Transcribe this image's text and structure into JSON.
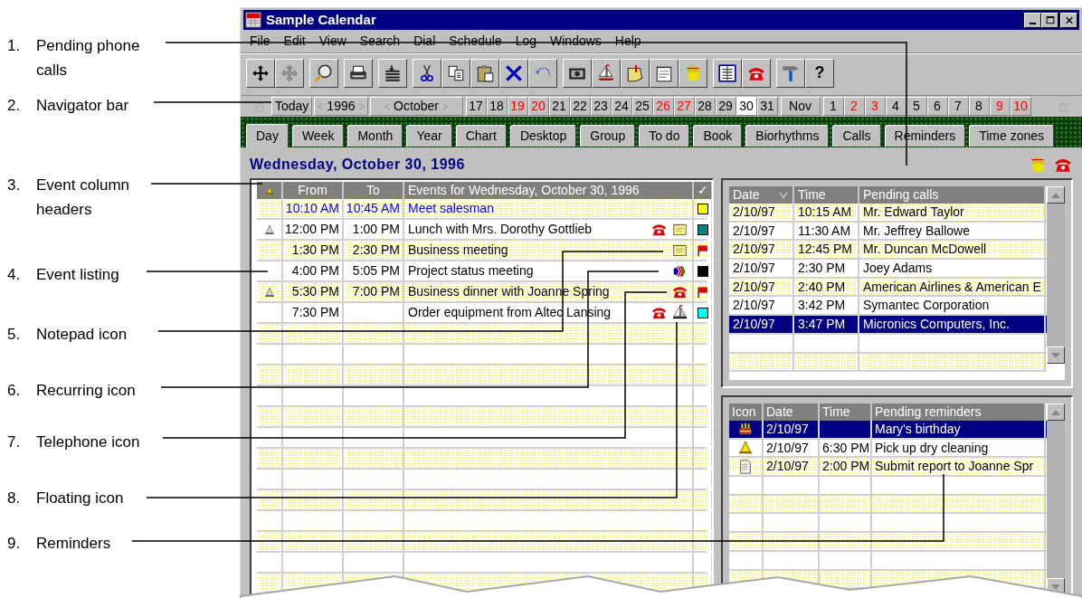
{
  "callouts": [
    {
      "number": "1.",
      "label": "Pending phone calls"
    },
    {
      "number": "2.",
      "label": "Navigator bar"
    },
    {
      "number": "3.",
      "label": "Event column headers"
    },
    {
      "number": "4.",
      "label": "Event listing"
    },
    {
      "number": "5.",
      "label": "Notepad icon"
    },
    {
      "number": "6.",
      "label": "Recurring icon"
    },
    {
      "number": "7.",
      "label": "Telephone icon"
    },
    {
      "number": "8.",
      "label": "Floating icon"
    },
    {
      "number": "9.",
      "label": "Reminders"
    }
  ],
  "window": {
    "title": "Sample Calendar"
  },
  "menu": [
    "File",
    "Edit",
    "View",
    "Search",
    "Dial",
    "Schedule",
    "Log",
    "Windows",
    "Help"
  ],
  "toolbar": {
    "help_label": "?"
  },
  "navigator": {
    "today": "Today",
    "year": "1996",
    "month": "October",
    "days": [
      {
        "label": "17",
        "weekend": false,
        "selected": false
      },
      {
        "label": "18",
        "weekend": false,
        "selected": false
      },
      {
        "label": "19",
        "weekend": true,
        "selected": false
      },
      {
        "label": "20",
        "weekend": true,
        "selected": false
      },
      {
        "label": "21",
        "weekend": false,
        "selected": false
      },
      {
        "label": "22",
        "weekend": false,
        "selected": false
      },
      {
        "label": "23",
        "weekend": false,
        "selected": false
      },
      {
        "label": "24",
        "weekend": false,
        "selected": false
      },
      {
        "label": "25",
        "weekend": false,
        "selected": false
      },
      {
        "label": "26",
        "weekend": true,
        "selected": false
      },
      {
        "label": "27",
        "weekend": true,
        "selected": false
      },
      {
        "label": "28",
        "weekend": false,
        "selected": false
      },
      {
        "label": "29",
        "weekend": false,
        "selected": false
      },
      {
        "label": "30",
        "weekend": false,
        "selected": true
      },
      {
        "label": "31",
        "weekend": false,
        "selected": false
      }
    ],
    "next_month": "Nov",
    "next_days": [
      {
        "label": "1",
        "weekend": false,
        "selected": false
      },
      {
        "label": "2",
        "weekend": true,
        "selected": false
      },
      {
        "label": "3",
        "weekend": true,
        "selected": false
      },
      {
        "label": "4",
        "weekend": false,
        "selected": false
      },
      {
        "label": "5",
        "weekend": false,
        "selected": false
      },
      {
        "label": "6",
        "weekend": false,
        "selected": false
      },
      {
        "label": "7",
        "weekend": false,
        "selected": false
      },
      {
        "label": "8",
        "weekend": false,
        "selected": false
      },
      {
        "label": "9",
        "weekend": true,
        "selected": false
      },
      {
        "label": "10",
        "weekend": true,
        "selected": false
      }
    ]
  },
  "tabs": [
    {
      "label": "Day",
      "selected": true
    },
    {
      "label": "Week",
      "selected": false
    },
    {
      "label": "Month",
      "selected": false
    },
    {
      "label": "Year",
      "selected": false
    },
    {
      "label": "Chart",
      "selected": false
    },
    {
      "label": "Desktop",
      "selected": false
    },
    {
      "label": "Group",
      "selected": false
    },
    {
      "label": "To do",
      "selected": false
    },
    {
      "label": "Book",
      "selected": false
    },
    {
      "label": "Biorhythms",
      "selected": false
    },
    {
      "label": "Calls",
      "selected": false
    },
    {
      "label": "Reminders",
      "selected": false
    },
    {
      "label": "Time zones",
      "selected": false
    }
  ],
  "date_heading": "Wednesday, October 30, 1996",
  "events": {
    "columns": [
      "From",
      "To",
      "Events for Wednesday, October 30, 1996",
      "✓"
    ],
    "rows": [
      {
        "alarm": false,
        "current": true,
        "from": "10:10 AM",
        "to": "10:45 AM",
        "title": "Meet salesman",
        "icons": [],
        "marker": {
          "kind": "square",
          "color": "#ffff00"
        }
      },
      {
        "alarm": true,
        "current": false,
        "from": "12:00 PM",
        "to": "1:00 PM",
        "title": "Lunch with Mrs. Dorothy Gottlieb",
        "icons": [
          {
            "kind": "phone"
          },
          {
            "kind": "notepad"
          }
        ],
        "marker": {
          "kind": "square",
          "color": "#008080"
        }
      },
      {
        "alarm": false,
        "current": false,
        "from": "1:30 PM",
        "to": "2:30 PM",
        "title": "Business meeting",
        "icons": [
          {
            "kind": "notepad"
          }
        ],
        "marker": {
          "kind": "flag"
        }
      },
      {
        "alarm": false,
        "current": false,
        "from": "4:00 PM",
        "to": "5:05 PM",
        "title": "Project status meeting",
        "icons": [
          {
            "kind": "recurring"
          }
        ],
        "marker": {
          "kind": "square",
          "color": "#000000"
        }
      },
      {
        "alarm": true,
        "current": false,
        "from": "5:30 PM",
        "to": "7:00 PM",
        "title": "Business dinner with Joanne Spring",
        "icons": [
          {
            "kind": "phone"
          }
        ],
        "marker": {
          "kind": "flag"
        }
      },
      {
        "alarm": false,
        "current": false,
        "from": "7:30 PM",
        "title": "Order equipment from Altec Lansing",
        "icons": [
          {
            "kind": "phone"
          },
          {
            "kind": "floating"
          }
        ],
        "marker": {
          "kind": "square",
          "color": "#00ffff"
        }
      }
    ]
  },
  "calls": {
    "columns": [
      "Date",
      "Time",
      "Pending calls"
    ],
    "rows": [
      {
        "date": "2/10/97",
        "time": "10:15 AM",
        "name": "Mr. Edward Taylor",
        "selected": false
      },
      {
        "date": "2/10/97",
        "time": "11:30 AM",
        "name": "Mr. Jeffrey Ballowe",
        "selected": false
      },
      {
        "date": "2/10/97",
        "time": "12:45 PM",
        "name": "Mr. Duncan McDowell",
        "selected": false
      },
      {
        "date": "2/10/97",
        "time": "2:30 PM",
        "name": "Joey Adams",
        "selected": false
      },
      {
        "date": "2/10/97",
        "time": "2:40 PM",
        "name": "American Airlines & American E",
        "selected": false
      },
      {
        "date": "2/10/97",
        "time": "3:42 PM",
        "name": "Symantec Corporation",
        "selected": false
      },
      {
        "date": "2/10/97",
        "time": "3:47 PM",
        "name": "Micronics Computers, Inc.",
        "selected": true
      }
    ]
  },
  "reminders": {
    "columns": [
      "Icon",
      "Date",
      "Time",
      "Pending reminders"
    ],
    "rows": [
      {
        "kind": "birthday",
        "date": "2/10/97",
        "text": "Mary's birthday",
        "selected": true
      },
      {
        "kind": "alarm",
        "date": "2/10/97",
        "time": "6:30 PM",
        "text": "Pick up dry cleaning",
        "selected": false
      },
      {
        "kind": "document",
        "date": "2/10/97",
        "time": "2:00 PM",
        "text": "Submit report to Joanne Spr",
        "selected": false
      }
    ]
  }
}
